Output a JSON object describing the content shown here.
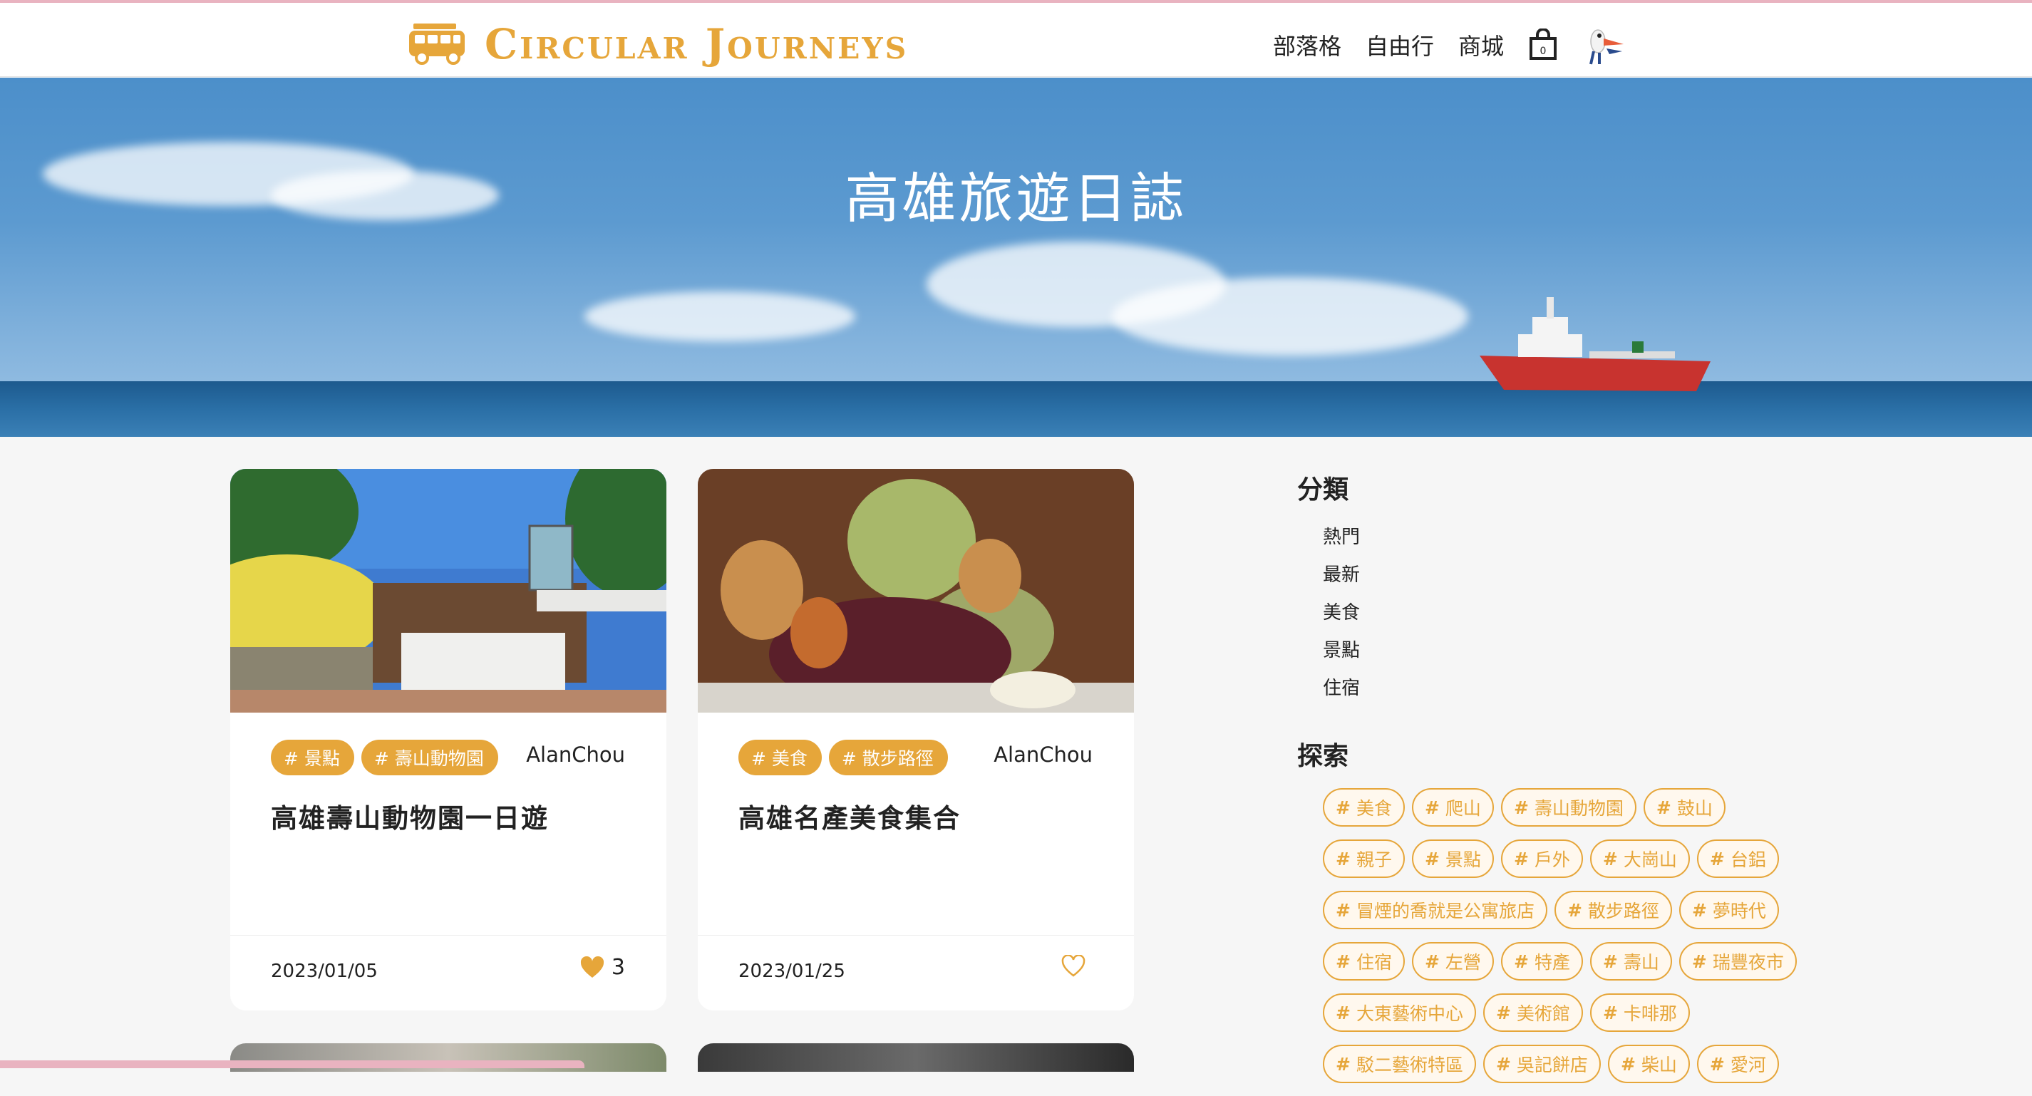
{
  "brand": {
    "name": "Circular Journeys"
  },
  "nav": {
    "items": [
      "部落格",
      "自由行",
      "商城"
    ]
  },
  "hero": {
    "title": "高雄旅遊日誌"
  },
  "cards": [
    {
      "tags": [
        "# 景點",
        "# 壽山動物園"
      ],
      "author": "AlanChou",
      "title": "高雄壽山動物園一日遊",
      "date": "2023/01/05",
      "likes": "3",
      "liked": true
    },
    {
      "tags": [
        "# 美食",
        "# 散步路徑"
      ],
      "author": "AlanChou",
      "title": "高雄名產美食集合",
      "date": "2023/01/25",
      "likes": "",
      "liked": false
    }
  ],
  "sidebar": {
    "category_heading": "分類",
    "categories": [
      "熱門",
      "最新",
      "美食",
      "景點",
      "住宿"
    ],
    "explore_heading": "探索",
    "explore_rows": [
      [
        "美食",
        "爬山",
        "壽山動物園",
        "鼓山"
      ],
      [
        "親子",
        "景點",
        "戶外",
        "大崗山",
        "台鋁"
      ],
      [
        "冒煙的喬就是公寓旅店",
        "散步路徑",
        "夢時代"
      ],
      [
        "住宿",
        "左營",
        "特產",
        "壽山",
        "瑞豐夜市"
      ],
      [
        "大東藝術中心",
        "美術館",
        "卡啡那"
      ],
      [
        "駁二藝術特區",
        "吳記餅店",
        "柴山",
        "愛河"
      ]
    ]
  },
  "colors": {
    "accent": "#e6a63a",
    "hero_sky": "#5c9ad0",
    "hero_sea": "#2a6fa6"
  },
  "icons": [
    "van-logo-icon",
    "shopping-bag-icon",
    "bird-avatar-icon",
    "heart-icon"
  ]
}
